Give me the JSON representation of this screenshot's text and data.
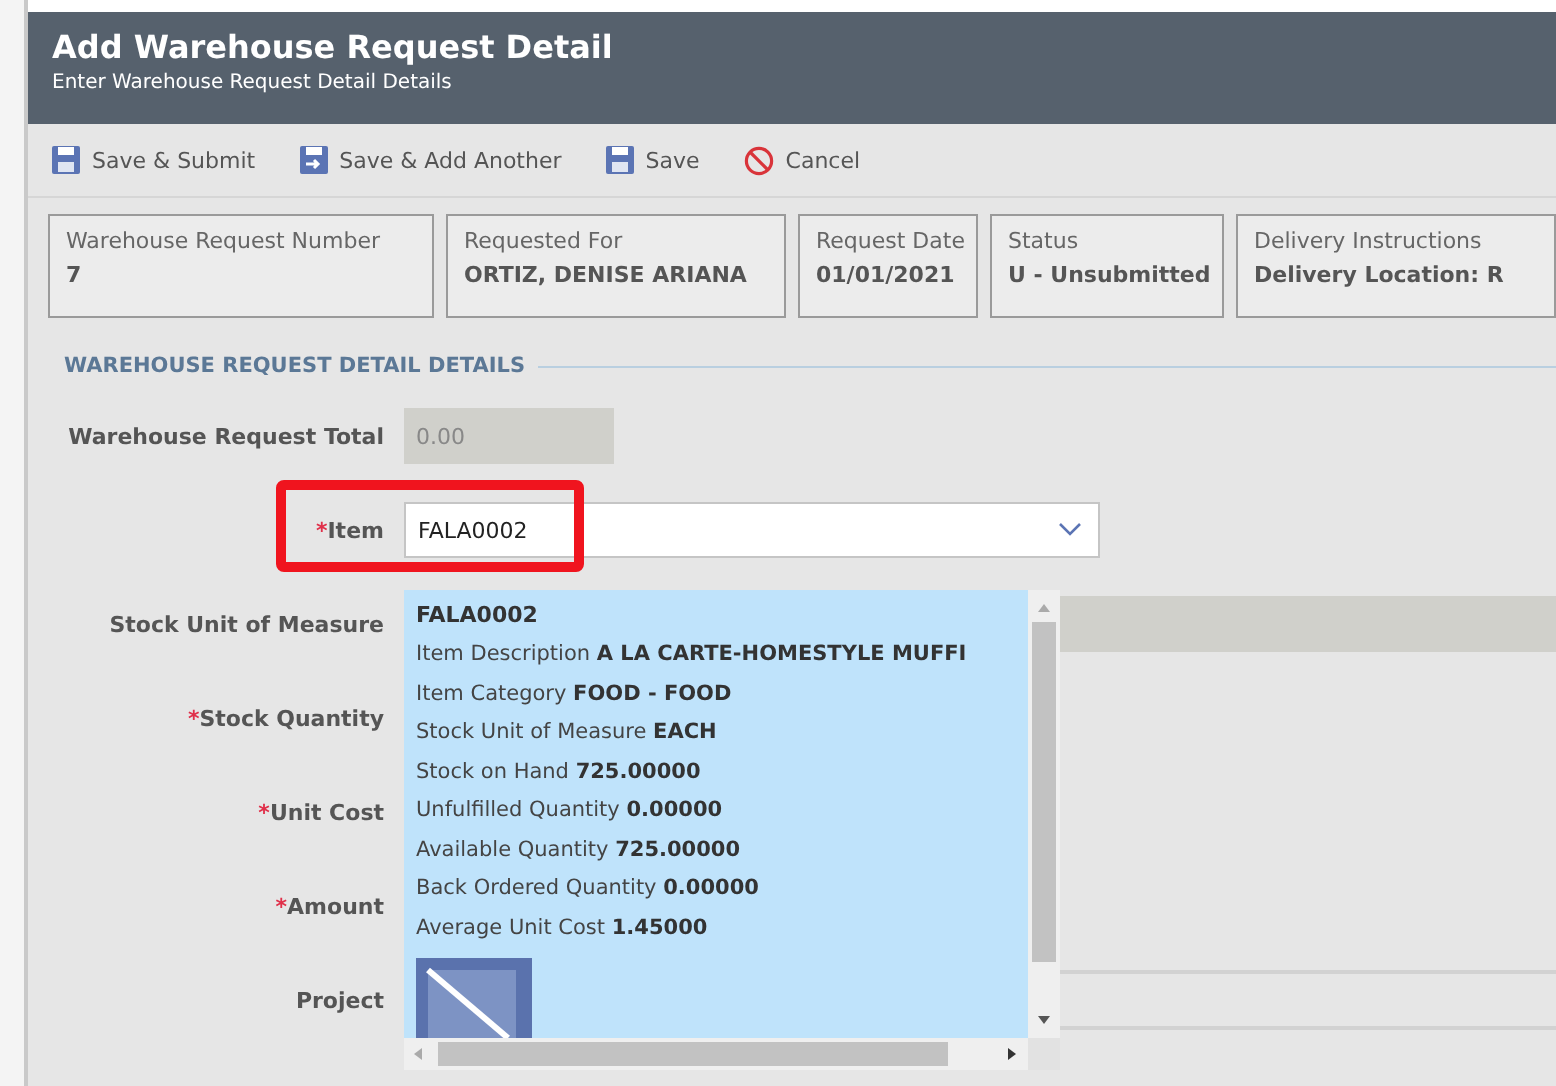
{
  "window": {
    "title": "Add Warehouse Request Detail",
    "subtitle": "Enter Warehouse Request Detail Details"
  },
  "toolbar": [
    {
      "kind": "save-submit",
      "label": "Save & Submit"
    },
    {
      "kind": "save-add",
      "label": "Save & Add Another"
    },
    {
      "kind": "save",
      "label": "Save"
    },
    {
      "kind": "cancel",
      "label": "Cancel"
    }
  ],
  "summary": [
    {
      "label": "Warehouse Request Number",
      "value": "7"
    },
    {
      "label": "Requested For",
      "value": "ORTIZ, DENISE ARIANA"
    },
    {
      "label": "Request Date",
      "value": "01/01/2021"
    },
    {
      "label": "Status",
      "value": "U - Unsubmitted"
    },
    {
      "label": "Delivery Instructions",
      "value": "Delivery Location: R"
    }
  ],
  "section": {
    "title": "WAREHOUSE REQUEST DETAIL DETAILS"
  },
  "fields": [
    {
      "label": "Warehouse Request Total",
      "required": false,
      "kind": "readonly",
      "value": "0.00"
    },
    {
      "label": "Item",
      "required": true,
      "kind": "combo",
      "value": "FALA0002",
      "highlighted": true
    },
    {
      "label": "Stock Unit of Measure",
      "required": false,
      "kind": "readonly-wide"
    },
    {
      "label": "Stock Quantity",
      "required": true
    },
    {
      "label": "Unit Cost",
      "required": true
    },
    {
      "label": "Amount",
      "required": true
    },
    {
      "label": "Project",
      "required": false,
      "kind": "lookup"
    }
  ],
  "required_mark": "*",
  "dropdown": {
    "code": "FALA0002",
    "details": [
      {
        "key": "Item Description",
        "value": "A LA CARTE-HOMESTYLE MUFFI"
      },
      {
        "key": "Item Category",
        "value": "FOOD - FOOD"
      },
      {
        "key": "Stock Unit of Measure",
        "value": "EACH"
      },
      {
        "key": "Stock on Hand",
        "value": "725.00000"
      },
      {
        "key": "Unfulfilled Quantity",
        "value": "0.00000"
      },
      {
        "key": "Available Quantity",
        "value": "725.00000"
      },
      {
        "key": "Back Ordered Quantity",
        "value": "0.00000"
      },
      {
        "key": "Average Unit Cost",
        "value": "1.45000"
      }
    ]
  }
}
